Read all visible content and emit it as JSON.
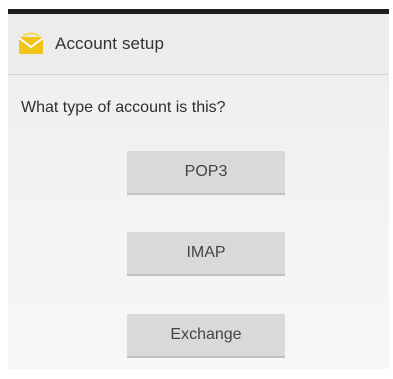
{
  "action_bar": {
    "title": "Account setup",
    "icon": "email-envelope-icon"
  },
  "main": {
    "prompt": "What type of account is this?",
    "buttons": [
      {
        "label": "POP3"
      },
      {
        "label": "IMAP"
      },
      {
        "label": "Exchange"
      }
    ]
  },
  "colors": {
    "status_bar": "#1e1e1e",
    "background": "#f0f0f0",
    "button": "#d9d9d9",
    "icon_yellow": "#f2c318"
  }
}
